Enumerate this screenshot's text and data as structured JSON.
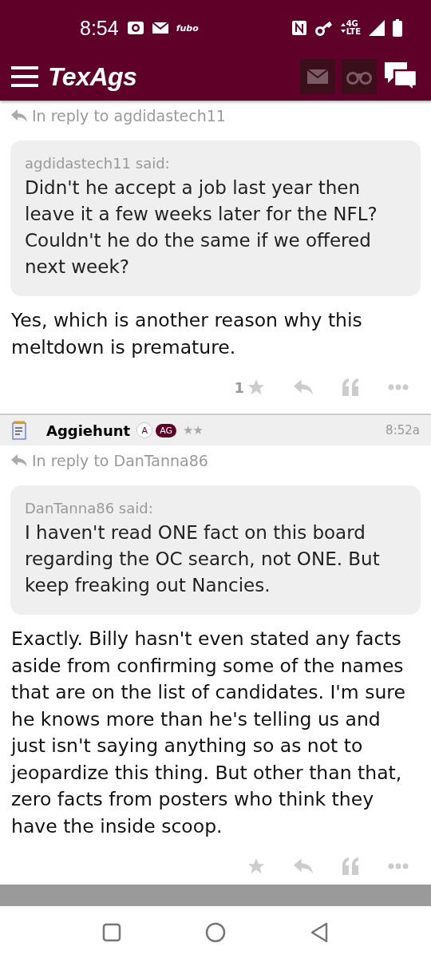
{
  "status_bar": {
    "time": "8:54",
    "app_label": "fubo",
    "network_top": "4G",
    "network_bottom": "LTE"
  },
  "header": {
    "logo": "TexAgs"
  },
  "posts": [
    {
      "reply_to": "In reply to agdidastech11",
      "quote": {
        "said": "agdidastech11 said:",
        "text": "Didn't he accept a job last year then leave it a few weeks later for the NFL? Couldn't he do the same if we offered next week?"
      },
      "body": "Yes, which is another reason why this meltdown is premature.",
      "likes": "1"
    },
    {
      "author": {
        "name": "Aggiehunt",
        "badges": [
          {
            "kind": "circle",
            "label": "A"
          },
          {
            "kind": "pill",
            "label": "AG"
          }
        ],
        "rank": "★★",
        "time": "8:52a"
      },
      "reply_to": "In reply to DanTanna86",
      "quote": {
        "said": "DanTanna86 said:",
        "text": "I haven't read ONE fact on this board regarding the OC search, not ONE. But keep freaking out Nancies."
      },
      "body": "Exactly. Billy hasn't even stated any facts aside from confirming some of the names that are on the list of candidates. I'm sure he knows more than he's telling us and just isn't saying anything so as not to jeopardize this thing. But other than that, zero facts from posters who think they have the inside scoop."
    }
  ]
}
